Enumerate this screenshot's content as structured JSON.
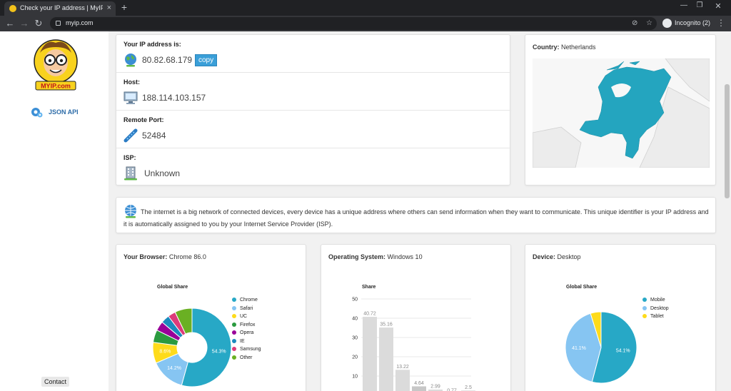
{
  "browser_chrome": {
    "tab_title": "Check your IP address | MyIP.com",
    "url": "myip.com",
    "profile_label": "Incognito (2)"
  },
  "sidebar": {
    "logo_text": "MYIP.com",
    "json_api_label": "JSON API",
    "contact_label": "Contact"
  },
  "ip_info": {
    "ip_label": "Your IP address is:",
    "ip_value": "80.82.68.179",
    "copy_label": "copy",
    "host_label": "Host:",
    "host_value": "188.114.103.157",
    "port_label": "Remote Port:",
    "port_value": "52484",
    "isp_label": "ISP:",
    "isp_value": "Unknown"
  },
  "country": {
    "label": "Country:",
    "value": "Netherlands",
    "map_color": "#24a5bf"
  },
  "info": {
    "text": "The internet is a big network of connected devices, every device has a unique address where others can send information when they want to communicate. This unique identifier is your IP address and it is automatically assigned to you by your Internet Service Provider (ISP)."
  },
  "browser": {
    "label": "Your Browser:",
    "value": "Chrome 86.0"
  },
  "os": {
    "label": "Operating System:",
    "value": "Windows 10"
  },
  "device": {
    "label": "Device:",
    "value": "Desktop"
  },
  "chart_data": [
    {
      "type": "pie",
      "title": "Global Share",
      "donut": true,
      "categories": [
        "Chrome",
        "Safari",
        "UC",
        "Firefox",
        "Opera",
        "IE",
        "Samsung",
        "Other"
      ],
      "values": [
        54.3,
        14.2,
        8.6,
        5.2,
        3.9,
        3.5,
        3.2,
        7.1
      ],
      "labels": [
        "54.3%",
        "14.2%",
        "8.6%",
        "",
        "",
        "",
        "",
        ""
      ],
      "colors": [
        "#27a8c6",
        "#86c5f2",
        "#fedb1b",
        "#2b9a3f",
        "#990099",
        "#1a8abe",
        "#dc3b7a",
        "#6ab023"
      ],
      "legend_position": "right"
    },
    {
      "type": "bar",
      "title": "Share",
      "categories": [
        "",
        "",
        "",
        "",
        "",
        "",
        ""
      ],
      "values": [
        40.72,
        35.16,
        13.22,
        4.64,
        2.99,
        0.77,
        2.5
      ],
      "ylim": [
        0,
        50
      ],
      "yticks": [
        50,
        40,
        30,
        20,
        10
      ],
      "grid": true,
      "bar_color": "#dbdbdb",
      "highlight_color": "#c7c7c7"
    },
    {
      "type": "pie",
      "title": "Global Share",
      "donut": false,
      "categories": [
        "Mobile",
        "Desktop",
        "Tablet"
      ],
      "values": [
        54.1,
        41.1,
        4.8
      ],
      "labels": [
        "54.1%",
        "41.1%",
        ""
      ],
      "colors": [
        "#27a8c6",
        "#86c5f2",
        "#fedb1b"
      ],
      "legend_position": "right"
    }
  ]
}
